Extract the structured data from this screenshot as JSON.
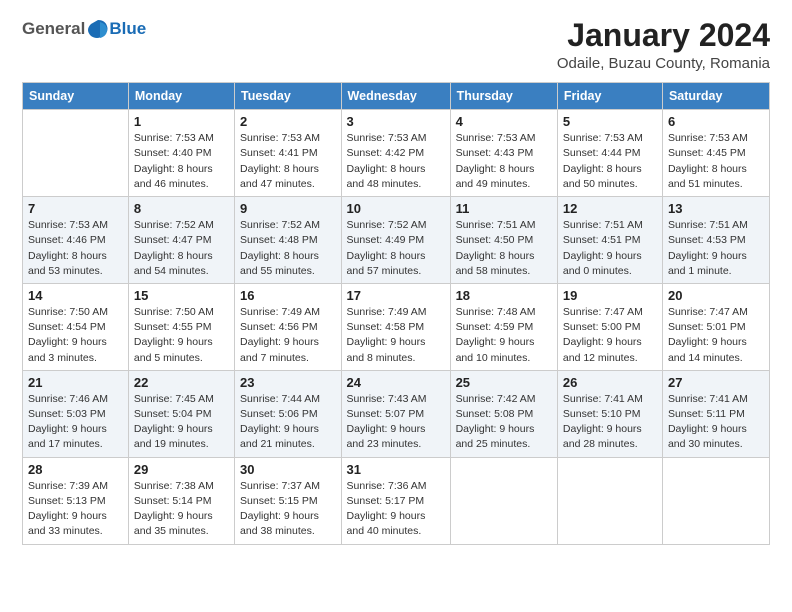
{
  "header": {
    "logo": {
      "general": "General",
      "blue": "Blue"
    },
    "title": "January 2024",
    "location": "Odaile, Buzau County, Romania"
  },
  "weekdays": [
    "Sunday",
    "Monday",
    "Tuesday",
    "Wednesday",
    "Thursday",
    "Friday",
    "Saturday"
  ],
  "weeks": [
    [
      {
        "day": "",
        "info": ""
      },
      {
        "day": "1",
        "info": "Sunrise: 7:53 AM\nSunset: 4:40 PM\nDaylight: 8 hours\nand 46 minutes."
      },
      {
        "day": "2",
        "info": "Sunrise: 7:53 AM\nSunset: 4:41 PM\nDaylight: 8 hours\nand 47 minutes."
      },
      {
        "day": "3",
        "info": "Sunrise: 7:53 AM\nSunset: 4:42 PM\nDaylight: 8 hours\nand 48 minutes."
      },
      {
        "day": "4",
        "info": "Sunrise: 7:53 AM\nSunset: 4:43 PM\nDaylight: 8 hours\nand 49 minutes."
      },
      {
        "day": "5",
        "info": "Sunrise: 7:53 AM\nSunset: 4:44 PM\nDaylight: 8 hours\nand 50 minutes."
      },
      {
        "day": "6",
        "info": "Sunrise: 7:53 AM\nSunset: 4:45 PM\nDaylight: 8 hours\nand 51 minutes."
      }
    ],
    [
      {
        "day": "7",
        "info": "Sunrise: 7:53 AM\nSunset: 4:46 PM\nDaylight: 8 hours\nand 53 minutes."
      },
      {
        "day": "8",
        "info": "Sunrise: 7:52 AM\nSunset: 4:47 PM\nDaylight: 8 hours\nand 54 minutes."
      },
      {
        "day": "9",
        "info": "Sunrise: 7:52 AM\nSunset: 4:48 PM\nDaylight: 8 hours\nand 55 minutes."
      },
      {
        "day": "10",
        "info": "Sunrise: 7:52 AM\nSunset: 4:49 PM\nDaylight: 8 hours\nand 57 minutes."
      },
      {
        "day": "11",
        "info": "Sunrise: 7:51 AM\nSunset: 4:50 PM\nDaylight: 8 hours\nand 58 minutes."
      },
      {
        "day": "12",
        "info": "Sunrise: 7:51 AM\nSunset: 4:51 PM\nDaylight: 9 hours\nand 0 minutes."
      },
      {
        "day": "13",
        "info": "Sunrise: 7:51 AM\nSunset: 4:53 PM\nDaylight: 9 hours\nand 1 minute."
      }
    ],
    [
      {
        "day": "14",
        "info": "Sunrise: 7:50 AM\nSunset: 4:54 PM\nDaylight: 9 hours\nand 3 minutes."
      },
      {
        "day": "15",
        "info": "Sunrise: 7:50 AM\nSunset: 4:55 PM\nDaylight: 9 hours\nand 5 minutes."
      },
      {
        "day": "16",
        "info": "Sunrise: 7:49 AM\nSunset: 4:56 PM\nDaylight: 9 hours\nand 7 minutes."
      },
      {
        "day": "17",
        "info": "Sunrise: 7:49 AM\nSunset: 4:58 PM\nDaylight: 9 hours\nand 8 minutes."
      },
      {
        "day": "18",
        "info": "Sunrise: 7:48 AM\nSunset: 4:59 PM\nDaylight: 9 hours\nand 10 minutes."
      },
      {
        "day": "19",
        "info": "Sunrise: 7:47 AM\nSunset: 5:00 PM\nDaylight: 9 hours\nand 12 minutes."
      },
      {
        "day": "20",
        "info": "Sunrise: 7:47 AM\nSunset: 5:01 PM\nDaylight: 9 hours\nand 14 minutes."
      }
    ],
    [
      {
        "day": "21",
        "info": "Sunrise: 7:46 AM\nSunset: 5:03 PM\nDaylight: 9 hours\nand 17 minutes."
      },
      {
        "day": "22",
        "info": "Sunrise: 7:45 AM\nSunset: 5:04 PM\nDaylight: 9 hours\nand 19 minutes."
      },
      {
        "day": "23",
        "info": "Sunrise: 7:44 AM\nSunset: 5:06 PM\nDaylight: 9 hours\nand 21 minutes."
      },
      {
        "day": "24",
        "info": "Sunrise: 7:43 AM\nSunset: 5:07 PM\nDaylight: 9 hours\nand 23 minutes."
      },
      {
        "day": "25",
        "info": "Sunrise: 7:42 AM\nSunset: 5:08 PM\nDaylight: 9 hours\nand 25 minutes."
      },
      {
        "day": "26",
        "info": "Sunrise: 7:41 AM\nSunset: 5:10 PM\nDaylight: 9 hours\nand 28 minutes."
      },
      {
        "day": "27",
        "info": "Sunrise: 7:41 AM\nSunset: 5:11 PM\nDaylight: 9 hours\nand 30 minutes."
      }
    ],
    [
      {
        "day": "28",
        "info": "Sunrise: 7:39 AM\nSunset: 5:13 PM\nDaylight: 9 hours\nand 33 minutes."
      },
      {
        "day": "29",
        "info": "Sunrise: 7:38 AM\nSunset: 5:14 PM\nDaylight: 9 hours\nand 35 minutes."
      },
      {
        "day": "30",
        "info": "Sunrise: 7:37 AM\nSunset: 5:15 PM\nDaylight: 9 hours\nand 38 minutes."
      },
      {
        "day": "31",
        "info": "Sunrise: 7:36 AM\nSunset: 5:17 PM\nDaylight: 9 hours\nand 40 minutes."
      },
      {
        "day": "",
        "info": ""
      },
      {
        "day": "",
        "info": ""
      },
      {
        "day": "",
        "info": ""
      }
    ]
  ]
}
